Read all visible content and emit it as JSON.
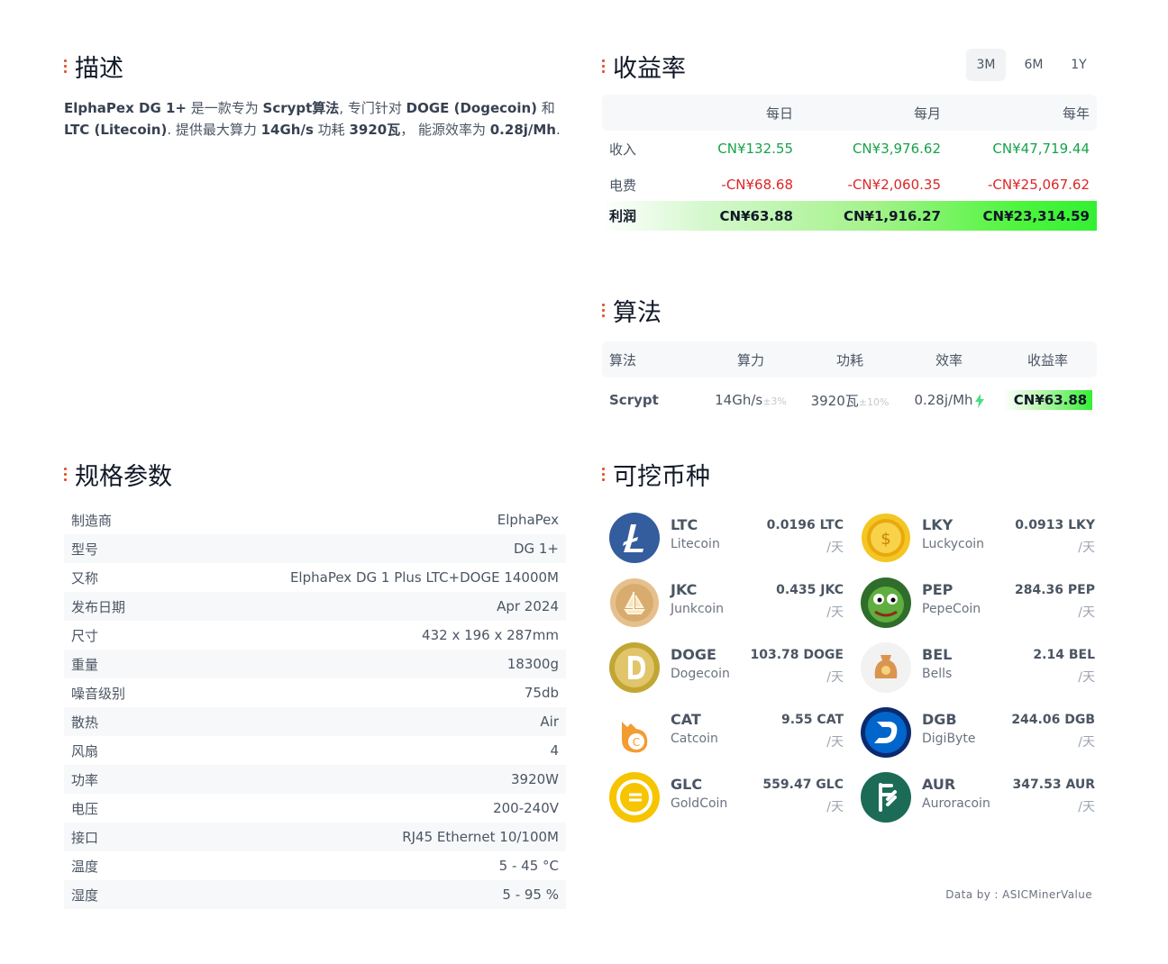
{
  "description": {
    "title": "描述",
    "parts": [
      {
        "text": "ElphaPex DG 1+",
        "bold": true
      },
      {
        "text": " 是一款专为 ",
        "bold": false
      },
      {
        "text": "Scrypt算法",
        "bold": true
      },
      {
        "text": ", 专门针对 ",
        "bold": false
      },
      {
        "text": "DOGE (Dogecoin)",
        "bold": true
      },
      {
        "text": " 和 ",
        "bold": false
      },
      {
        "text": "LTC (Litecoin)",
        "bold": true
      },
      {
        "text": ". 提供最大算力 ",
        "bold": false
      },
      {
        "text": "14Gh/s",
        "bold": true
      },
      {
        "text": " 功耗 ",
        "bold": false
      },
      {
        "text": "3920瓦",
        "bold": true
      },
      {
        "text": "， 能源效率为 ",
        "bold": false
      },
      {
        "text": "0.28j/Mh",
        "bold": true
      },
      {
        "text": ".",
        "bold": false
      }
    ]
  },
  "profitability": {
    "title": "收益率",
    "periods": [
      "3M",
      "6M",
      "1Y"
    ],
    "active_period": "3M",
    "headers": [
      "",
      "每日",
      "每月",
      "每年"
    ],
    "income": {
      "label": "收入",
      "values": [
        "CN¥132.55",
        "CN¥3,976.62",
        "CN¥47,719.44"
      ]
    },
    "electricity": {
      "label": "电费",
      "values": [
        "-CN¥68.68",
        "-CN¥2,060.35",
        "-CN¥25,067.62"
      ]
    },
    "profit": {
      "label": "利润",
      "values": [
        "CN¥63.88",
        "CN¥1,916.27",
        "CN¥23,314.59"
      ]
    },
    "colors": {
      "positive": "#16a34a",
      "negative": "#dc2626",
      "highlight": "#33f033"
    }
  },
  "algorithm": {
    "title": "算法",
    "headers": [
      "算法",
      "算力",
      "功耗",
      "效率",
      "收益率"
    ],
    "row": {
      "name": "Scrypt",
      "hashrate": "14Gh/s",
      "hashrate_tol": "±3%",
      "power": "3920瓦",
      "power_tol": "±10%",
      "efficiency": "0.28j/Mh",
      "revenue": "CN¥63.88"
    }
  },
  "specs": {
    "title": "规格参数",
    "rows": [
      {
        "label": "制造商",
        "value": "ElphaPex"
      },
      {
        "label": "型号",
        "value": "DG 1+"
      },
      {
        "label": "又称",
        "value": "ElphaPex DG 1 Plus LTC+DOGE 14000M"
      },
      {
        "label": "发布日期",
        "value": "Apr 2024"
      },
      {
        "label": "尺寸",
        "value": "432 x 196 x 287mm"
      },
      {
        "label": "重量",
        "value": "18300g"
      },
      {
        "label": "噪音级别",
        "value": "75db"
      },
      {
        "label": "散热",
        "value": "Air"
      },
      {
        "label": "风扇",
        "value": "4"
      },
      {
        "label": "功率",
        "value": "3920W"
      },
      {
        "label": "电压",
        "value": "200-240V"
      },
      {
        "label": "接口",
        "value": "RJ45 Ethernet 10/100M"
      },
      {
        "label": "温度",
        "value": "5 - 45 °C"
      },
      {
        "label": "湿度",
        "value": "5 - 95 %"
      }
    ]
  },
  "coins": {
    "title": "可挖币种",
    "per_day": "/天",
    "items": [
      {
        "symbol": "LTC",
        "name": "Litecoin",
        "amount": "0.0196 LTC",
        "icon": "litecoin-icon",
        "color": "#345d9d"
      },
      {
        "symbol": "LKY",
        "name": "Luckycoin",
        "amount": "0.0913 LKY",
        "icon": "luckycoin-icon",
        "color": "#f0b90b"
      },
      {
        "symbol": "JKC",
        "name": "Junkcoin",
        "amount": "0.435 JKC",
        "icon": "junkcoin-icon",
        "color": "#d9b27c"
      },
      {
        "symbol": "PEP",
        "name": "PepeCoin",
        "amount": "284.36 PEP",
        "icon": "pepecoin-icon",
        "color": "#3f8f2f"
      },
      {
        "symbol": "DOGE",
        "name": "Dogecoin",
        "amount": "103.78 DOGE",
        "icon": "dogecoin-icon",
        "color": "#c2a633"
      },
      {
        "symbol": "BEL",
        "name": "Bells",
        "amount": "2.14 BEL",
        "icon": "bells-icon",
        "color": "#c8874a"
      },
      {
        "symbol": "CAT",
        "name": "Catcoin",
        "amount": "9.55 CAT",
        "icon": "catcoin-icon",
        "color": "#f39c32"
      },
      {
        "symbol": "DGB",
        "name": "DigiByte",
        "amount": "244.06 DGB",
        "icon": "digibyte-icon",
        "color": "#0b2a6f"
      },
      {
        "symbol": "GLC",
        "name": "GoldCoin",
        "amount": "559.47 GLC",
        "icon": "goldcoin-icon",
        "color": "#f7c400"
      },
      {
        "symbol": "AUR",
        "name": "Auroracoin",
        "amount": "347.53 AUR",
        "icon": "auroracoin-icon",
        "color": "#1c6b57"
      }
    ]
  },
  "footer": {
    "text": "Data by : ASICMinerValue"
  }
}
